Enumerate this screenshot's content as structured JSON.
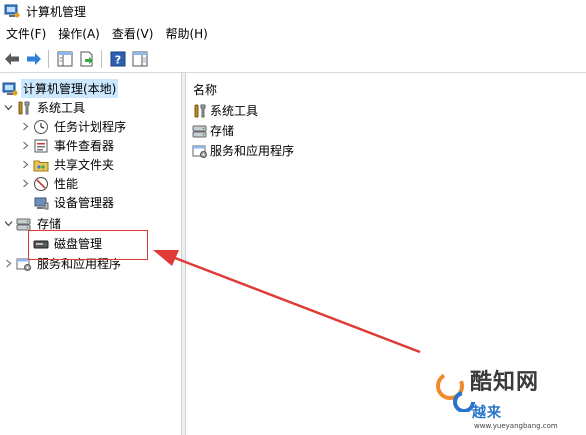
{
  "window": {
    "title": "计算机管理"
  },
  "menu": {
    "items": [
      "文件(F)",
      "操作(A)",
      "查看(V)",
      "帮助(H)"
    ]
  },
  "toolbar": {
    "buttons": [
      "back-arrow-icon",
      "forward-arrow-icon",
      "show-hide-console-tree-icon",
      "export-list-icon",
      "help-icon",
      "properties-icon"
    ]
  },
  "tree": {
    "root": "计算机管理(本地)",
    "system_tools": "系统工具",
    "task_scheduler": "任务计划程序",
    "event_viewer": "事件查看器",
    "shared_folders": "共享文件夹",
    "performance": "性能",
    "device_manager": "设备管理器",
    "storage": "存储",
    "disk_management": "磁盘管理",
    "services_apps": "服务和应用程序"
  },
  "list": {
    "header_name": "名称",
    "items": [
      "系统工具",
      "存储",
      "服务和应用程序"
    ]
  },
  "watermark": {
    "brand": "酷知网",
    "subtitle": "越来",
    "url": "www.yueyangbang.com"
  },
  "colors": {
    "selection": "#cce8ff",
    "annotation_red": "#e03a36",
    "watermark_blue": "#2a74c9"
  }
}
